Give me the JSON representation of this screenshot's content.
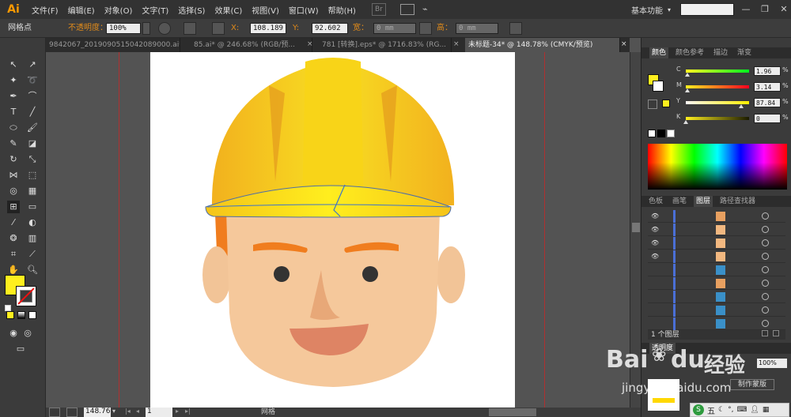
{
  "app": {
    "logo": "Ai"
  },
  "menu": [
    "文件(F)",
    "编辑(E)",
    "对象(O)",
    "文字(T)",
    "选择(S)",
    "效果(C)",
    "视图(V)",
    "窗口(W)",
    "帮助(H)"
  ],
  "menu_extra": {
    "br": "Br",
    "workspace": "基本功能",
    "workspace_caret": "▾"
  },
  "window_controls": {
    "minimize": "—",
    "restore": "❐",
    "close": "✕"
  },
  "control_bar": {
    "selection_label": "网格点",
    "opacity_label": "不透明度：",
    "opacity_value": "100%",
    "x_label": "X:",
    "x_value": "108.189",
    "y_label": "Y:",
    "y_value": "92.602",
    "width_label": "宽：",
    "width_value": "0 mm",
    "height_label": "高：",
    "height_value": "0 mm"
  },
  "tabs": [
    {
      "label": "9842067_2019090515042089000.ai*",
      "active": false
    },
    {
      "label": "85.ai* @ 246.68% (RGB/预...",
      "active": false
    },
    {
      "label": "781 [转换].eps* @ 1716.83% (RG...",
      "active": false
    },
    {
      "label": "未标题-34* @ 148.78% (CMYK/预览)",
      "active": true
    }
  ],
  "tab_close": "×",
  "status": {
    "zoom": "148.76",
    "page": "1",
    "mode": "网格"
  },
  "color_panel": {
    "tabs": [
      "颜色",
      "颜色参考",
      "描边",
      "渐变"
    ],
    "channels": [
      {
        "label": "C",
        "value": "1.96",
        "unit": "%",
        "level": 0.02
      },
      {
        "label": "M",
        "value": "3.14",
        "unit": "%",
        "level": 0.03
      },
      {
        "label": "Y",
        "value": "87.84",
        "unit": "%",
        "level": 0.88
      },
      {
        "label": "K",
        "value": "0",
        "unit": "%",
        "level": 0.0
      }
    ],
    "fill_color": "#ffef1e"
  },
  "layers_panel": {
    "tabs": [
      "色板",
      "画笔",
      "图层",
      "路径查找器"
    ],
    "footer": "1 个图层",
    "rows": [
      {
        "visible": true,
        "thumb": "#e8a060"
      },
      {
        "visible": true,
        "thumb": "#f2b880"
      },
      {
        "visible": true,
        "thumb": "#f2b880"
      },
      {
        "visible": true,
        "thumb": "#f2b880"
      },
      {
        "visible": false,
        "thumb": "#3a90c8"
      },
      {
        "visible": false,
        "thumb": "#e8a060"
      },
      {
        "visible": false,
        "thumb": "#3a90c8"
      },
      {
        "visible": false,
        "thumb": "#3a90c8"
      },
      {
        "visible": false,
        "thumb": "#3a90c8"
      }
    ]
  },
  "transparency_panel": {
    "tab": "透明度",
    "opacity": "100%",
    "mask_button": "制作蒙版"
  },
  "watermark": {
    "brand": "Bai",
    "brand2": "du",
    "jingyan": "经验",
    "url": "jingyan.baidu.com"
  },
  "ime_bar": {
    "label": "五"
  }
}
